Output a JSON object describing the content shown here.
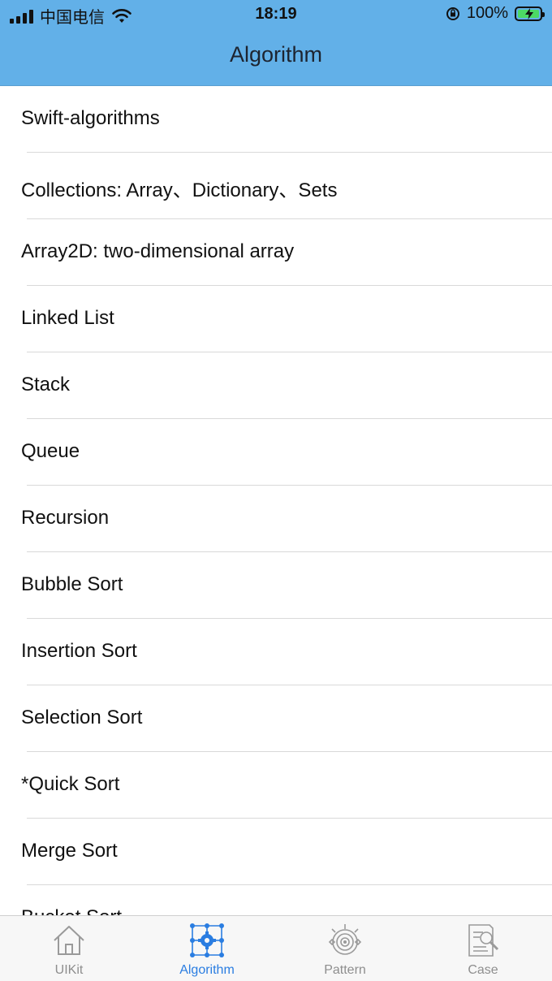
{
  "status_bar": {
    "carrier": "中国电信",
    "time": "18:19",
    "battery_percent": "100%",
    "battery_level": 1.0,
    "charging": true
  },
  "nav": {
    "title": "Algorithm"
  },
  "list": {
    "items": [
      {
        "label": "Swift-algorithms"
      },
      {
        "label": "Collections: Array、Dictionary、Sets"
      },
      {
        "label": "Array2D: two-dimensional array"
      },
      {
        "label": "Linked List"
      },
      {
        "label": "Stack"
      },
      {
        "label": "Queue"
      },
      {
        "label": "Recursion"
      },
      {
        "label": "Bubble Sort"
      },
      {
        "label": "Insertion Sort"
      },
      {
        "label": "Selection Sort"
      },
      {
        "label": "*Quick Sort"
      },
      {
        "label": "Merge Sort"
      },
      {
        "label": "Bucket Sort"
      }
    ]
  },
  "tabbar": {
    "tabs": [
      {
        "label": "UIKit",
        "icon": "house-icon",
        "active": false
      },
      {
        "label": "Algorithm",
        "icon": "network-gear-icon",
        "active": true
      },
      {
        "label": "Pattern",
        "icon": "target-icon",
        "active": false
      },
      {
        "label": "Case",
        "icon": "document-search-icon",
        "active": false
      }
    ]
  },
  "colors": {
    "nav_background": "#62b0e8",
    "active_tab": "#2a7de1",
    "inactive_tab": "#8e8e8e",
    "battery_fill": "#4cd964"
  }
}
